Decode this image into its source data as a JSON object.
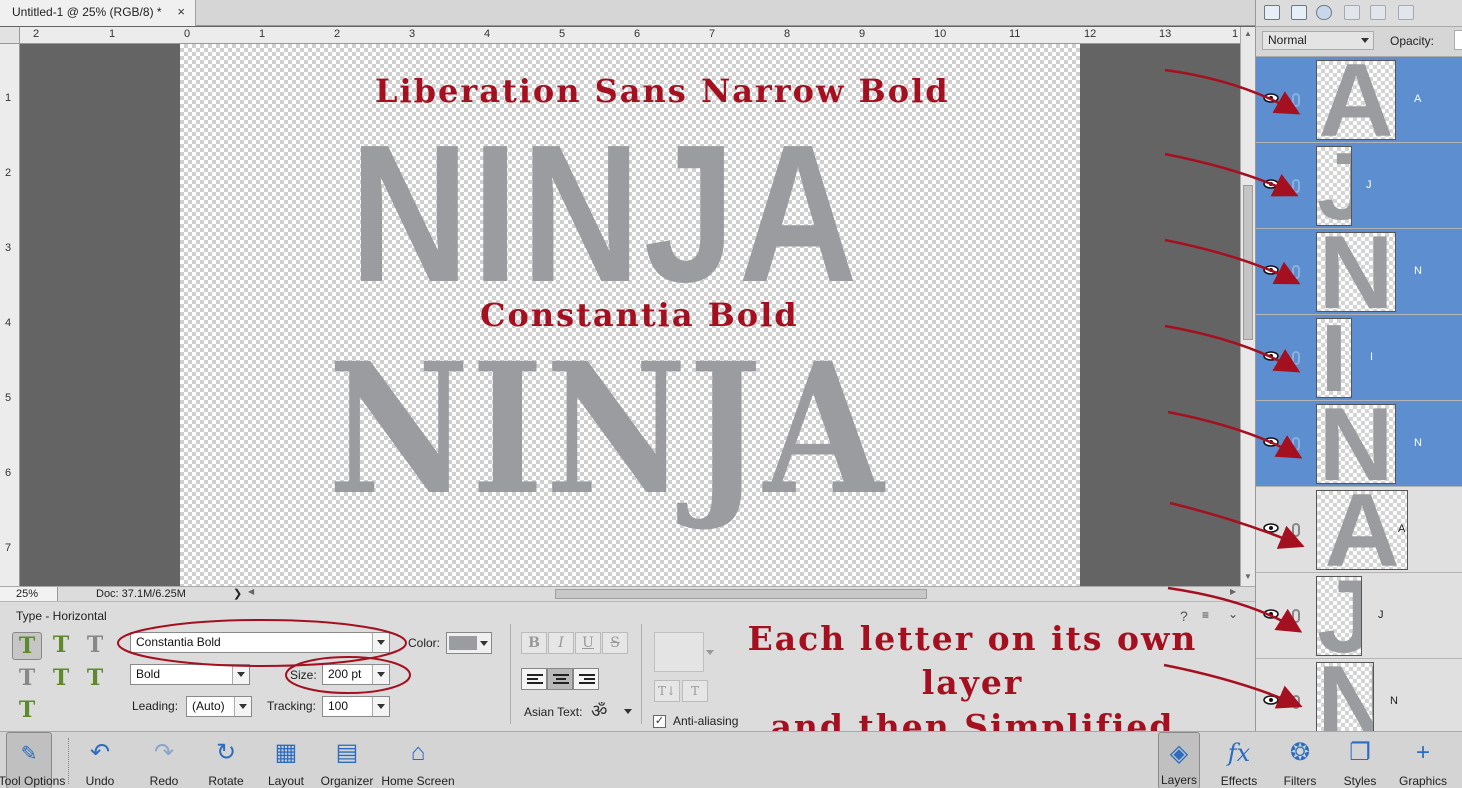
{
  "document": {
    "tab_title": "Untitled-1 @ 25% (RGB/8) *",
    "close_glyph": "×"
  },
  "rulers": {
    "top_ticks": [
      "2",
      "1",
      "0",
      "1",
      "2",
      "3",
      "4",
      "5",
      "6",
      "7",
      "8",
      "9",
      "10",
      "11",
      "12",
      "13",
      "1"
    ],
    "left_ticks": [
      "1",
      "2",
      "3",
      "4",
      "5",
      "6",
      "7"
    ]
  },
  "canvas": {
    "caption_top": "Liberation Sans Narrow Bold",
    "word_top": "NINJA",
    "caption_bottom": "Constantia Bold",
    "word_bottom": "NINJA"
  },
  "status": {
    "zoom": "25%",
    "doc_size": "Doc: 37.1M/6.25M"
  },
  "tool_options": {
    "title": "Type - Horizontal",
    "font_family": "Constantia Bold",
    "font_style": "Bold",
    "color_label": "Color:",
    "color_value": "#9a9ca0",
    "size_label": "Size:",
    "size_value": "200 pt",
    "leading_label": "Leading:",
    "leading_value": "(Auto)",
    "tracking_label": "Tracking:",
    "tracking_value": "100",
    "bold_glyph": "B",
    "italic_glyph": "I",
    "underline_glyph": "U",
    "strike_glyph": "S",
    "asian_text_label": "Asian Text:",
    "anti_aliasing_label": "Anti-aliasing",
    "anti_aliasing_checked": true,
    "note_line1": "Each letter on its own layer",
    "note_line2": "and then Simplified"
  },
  "layers_panel": {
    "blend_mode": "Normal",
    "opacity_label": "Opacity:",
    "layers": [
      {
        "name": "A",
        "selected": true
      },
      {
        "name": "J",
        "selected": true
      },
      {
        "name": "N",
        "selected": true
      },
      {
        "name": "I",
        "selected": true
      },
      {
        "name": "N",
        "selected": true
      },
      {
        "name": "A",
        "selected": false
      },
      {
        "name": "J",
        "selected": false
      },
      {
        "name": "N",
        "selected": false
      }
    ]
  },
  "taskbar": {
    "left": [
      "Tool Options",
      "Undo",
      "Redo",
      "Rotate",
      "Layout",
      "Organizer",
      "Home Screen"
    ],
    "right": [
      "Layers",
      "Effects",
      "Filters",
      "Styles",
      "Graphics"
    ]
  },
  "colors": {
    "annotation_red": "#a51020",
    "selection_blue": "#5d8ecf",
    "text_gray": "#9a9ca0"
  }
}
